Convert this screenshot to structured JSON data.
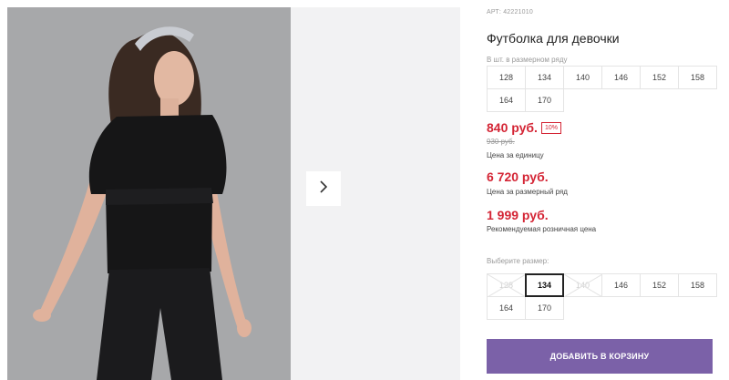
{
  "product": {
    "sku": "АРТ: 42221010",
    "title": "Футболка для девочки"
  },
  "size_row": {
    "label": "В шт. в размерном ряду",
    "sizes": [
      "128",
      "134",
      "140",
      "146",
      "152",
      "158",
      "164",
      "170"
    ]
  },
  "prices": {
    "unit_price": "840 руб.",
    "discount_badge": "10%",
    "old_price": "930 руб.",
    "unit_note": "Цена за единицу",
    "row_price": "6 720 руб.",
    "row_note": "Цена за размерный ряд",
    "retail_price": "1 999 руб.",
    "retail_note": "Рекомендуемая розничная цена"
  },
  "size_select": {
    "label": "Выберите размер:",
    "options": [
      {
        "label": "128",
        "state": "disabled"
      },
      {
        "label": "134",
        "state": "selected"
      },
      {
        "label": "140",
        "state": "disabled"
      },
      {
        "label": "146",
        "state": "available"
      },
      {
        "label": "152",
        "state": "available"
      },
      {
        "label": "158",
        "state": "available"
      },
      {
        "label": "164",
        "state": "available"
      },
      {
        "label": "170",
        "state": "available"
      }
    ]
  },
  "actions": {
    "add_to_cart": "ДОБАВИТЬ В КОРЗИНУ"
  },
  "gallery": {
    "next_icon": "chevron-right-icon"
  },
  "colors": {
    "price_red": "#d42535",
    "button_purple": "#7b61a8",
    "photo_bg": "#a9a9ab"
  }
}
